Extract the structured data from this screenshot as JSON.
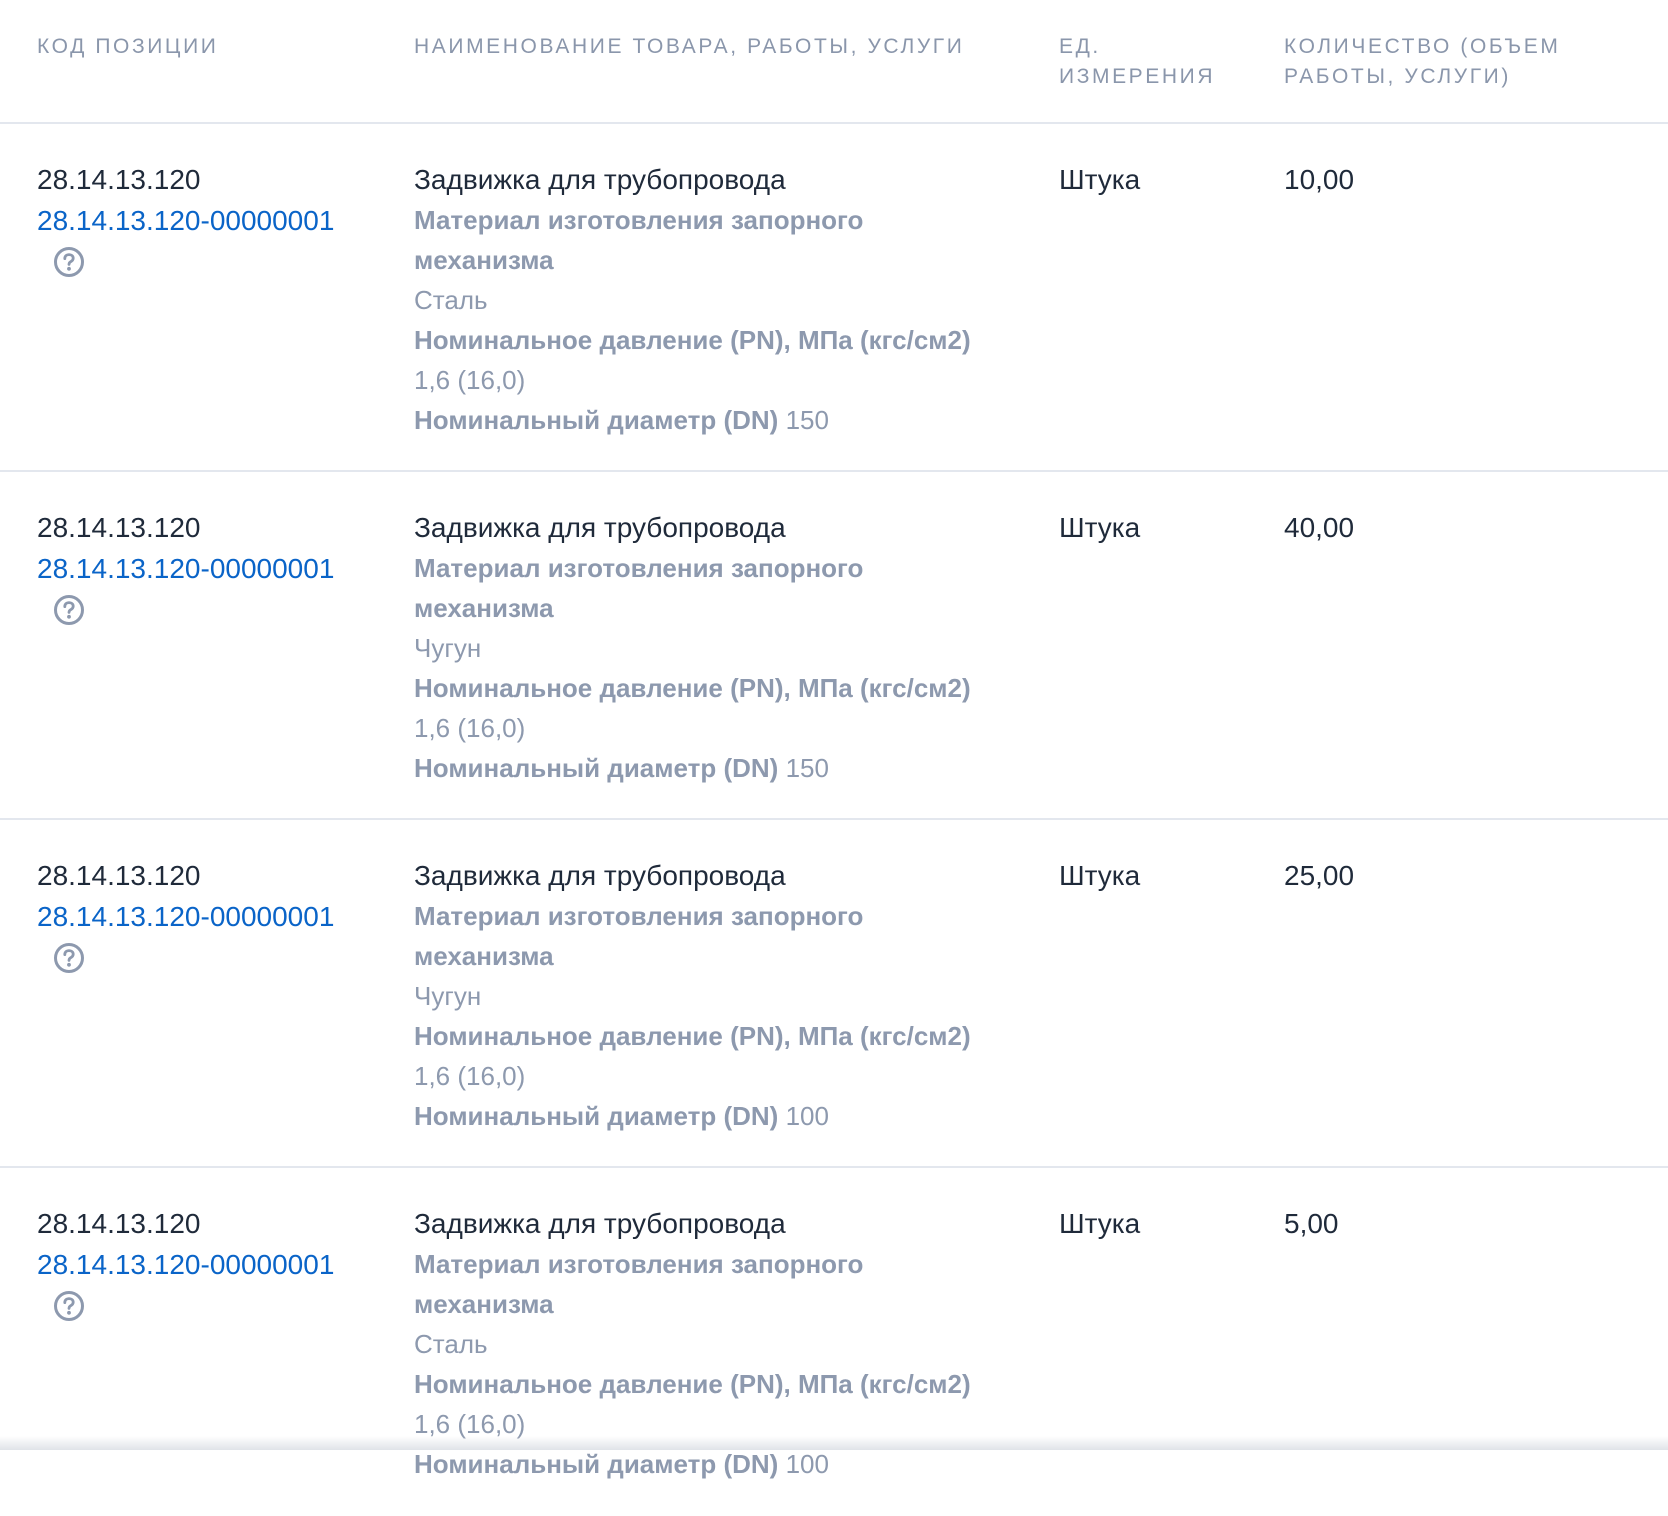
{
  "header": {
    "code": "КОД ПОЗИЦИИ",
    "name": "НАИМЕНОВАНИЕ ТОВАРА, РАБОТЫ, УСЛУГИ",
    "unit": "ЕД. ИЗМЕРЕНИЯ",
    "qty": "КОЛИЧЕСТВО (ОБЪЕМ РАБОТЫ, УСЛУГИ)"
  },
  "rows": [
    {
      "code": "28.14.13.120",
      "code_link": "28.14.13.120-00000001",
      "name": "Задвижка для трубопровода",
      "attr_material_label": "Материал изготовления запорного механизма",
      "attr_material_value": "Сталь",
      "attr_pressure_label": "Номинальное давление (PN), МПа (кгс/см2)",
      "attr_pressure_value": "1,6 (16,0)",
      "attr_diameter_label": "Номинальный диаметр (DN)",
      "attr_diameter_value": "150",
      "unit": "Штука",
      "qty": "10,00"
    },
    {
      "code": "28.14.13.120",
      "code_link": "28.14.13.120-00000001",
      "name": "Задвижка для трубопровода",
      "attr_material_label": "Материал изготовления запорного механизма",
      "attr_material_value": "Чугун",
      "attr_pressure_label": "Номинальное давление (PN), МПа (кгс/см2)",
      "attr_pressure_value": "1,6 (16,0)",
      "attr_diameter_label": "Номинальный диаметр (DN)",
      "attr_diameter_value": "150",
      "unit": "Штука",
      "qty": "40,00"
    },
    {
      "code": "28.14.13.120",
      "code_link": "28.14.13.120-00000001",
      "name": "Задвижка для трубопровода",
      "attr_material_label": "Материал изготовления запорного механизма",
      "attr_material_value": "Чугун",
      "attr_pressure_label": "Номинальное давление (PN), МПа (кгс/см2)",
      "attr_pressure_value": "1,6 (16,0)",
      "attr_diameter_label": "Номинальный диаметр (DN)",
      "attr_diameter_value": "100",
      "unit": "Штука",
      "qty": "25,00"
    },
    {
      "code": "28.14.13.120",
      "code_link": "28.14.13.120-00000001",
      "name": "Задвижка для трубопровода",
      "attr_material_label": "Материал изготовления запорного механизма",
      "attr_material_value": "Сталь",
      "attr_pressure_label": "Номинальное давление (PN), МПа (кгс/см2)",
      "attr_pressure_value": "1,6 (16,0)",
      "attr_diameter_label": "Номинальный диаметр (DN)",
      "attr_diameter_value": "100",
      "unit": "Штука",
      "qty": "5,00"
    }
  ],
  "colors": {
    "link": "#0a64c8",
    "muted": "#8d99ae",
    "header": "#8a96ab",
    "text": "#1f2a3a",
    "divider": "#e3e7ee"
  },
  "icons": {
    "help": "question-circle-icon"
  }
}
